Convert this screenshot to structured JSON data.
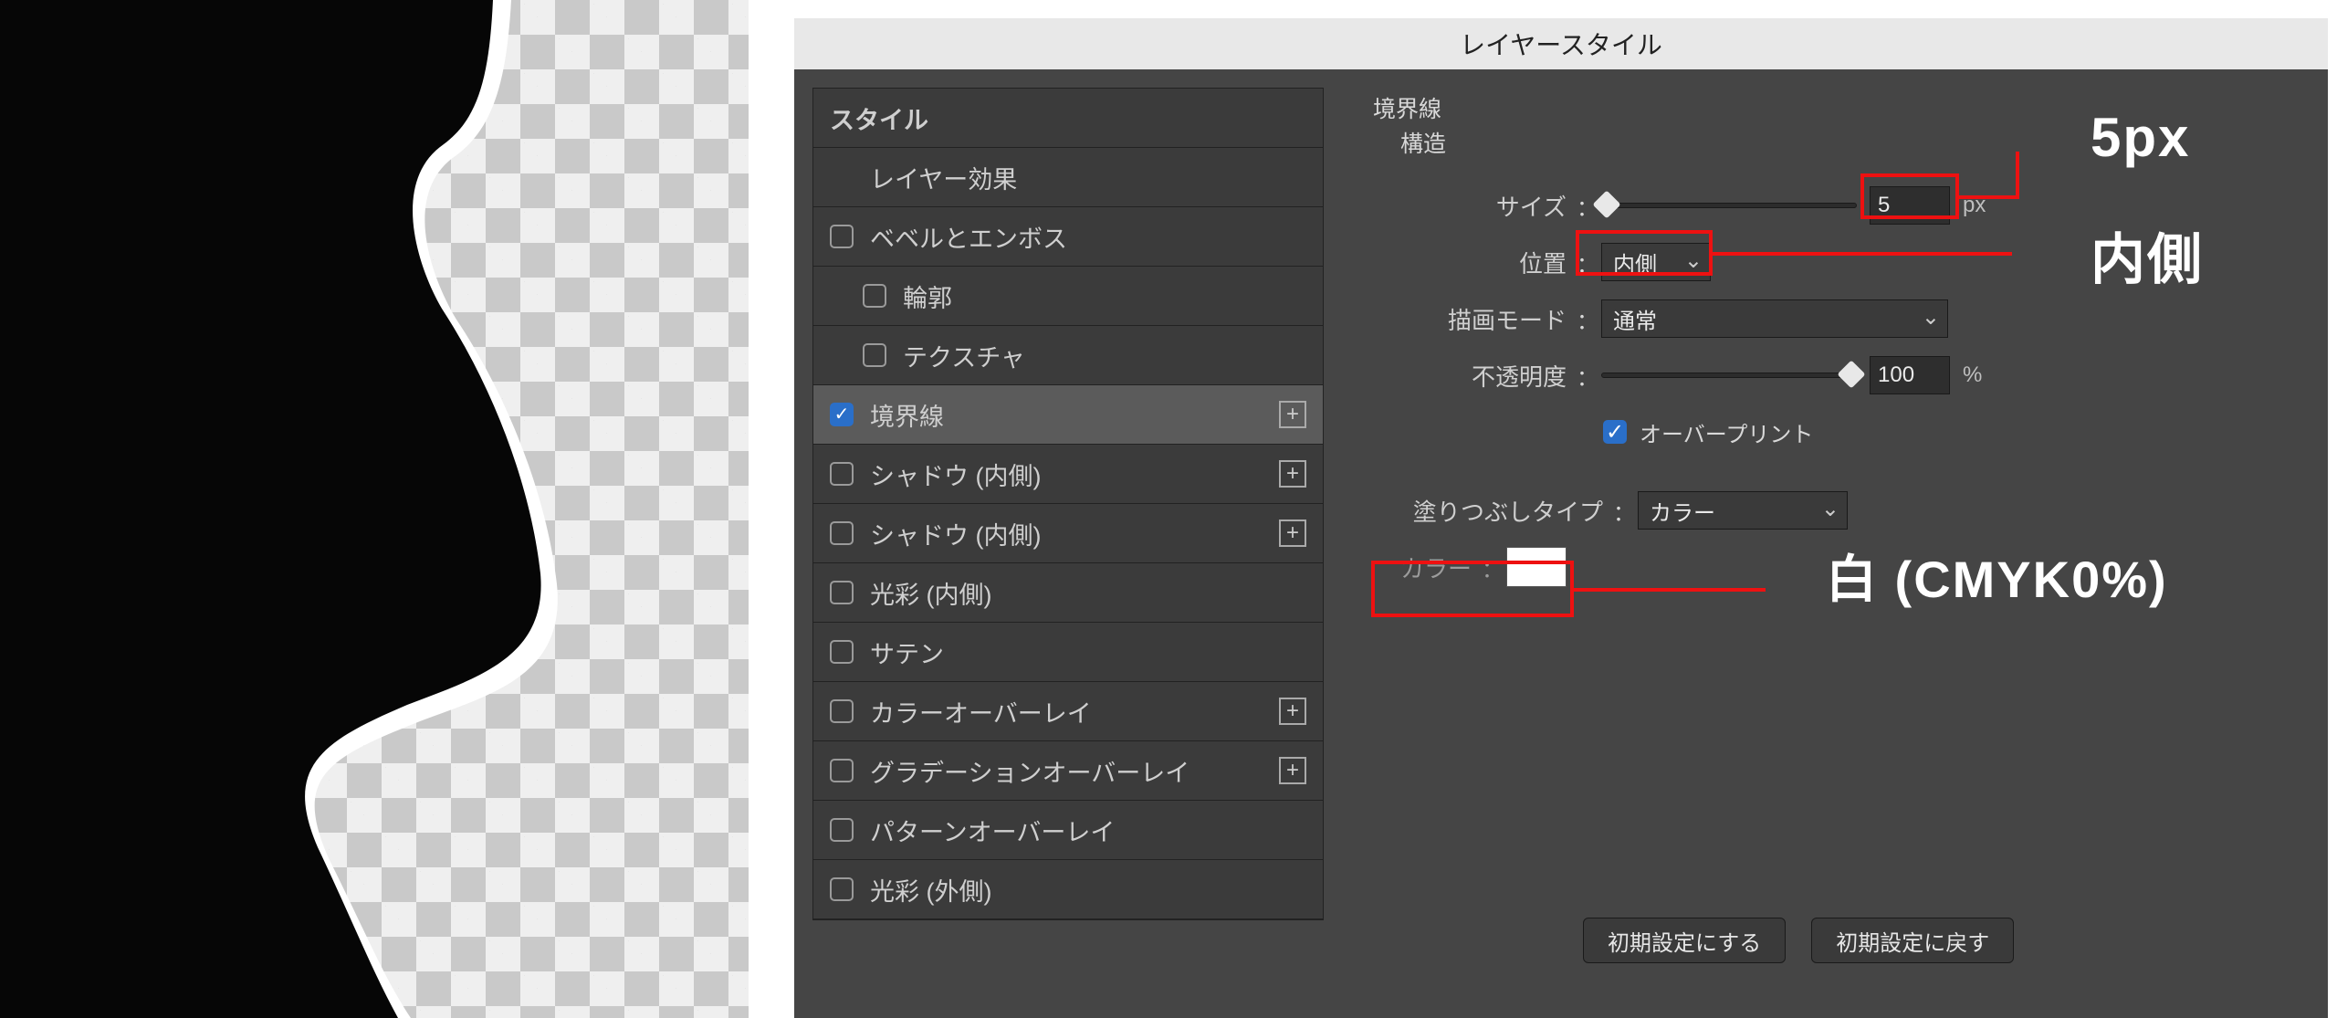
{
  "dialog": {
    "title": "レイヤースタイル",
    "styles_header": "スタイル",
    "styles": [
      {
        "label": "レイヤー効果",
        "checkbox": false,
        "checked": false,
        "plus": false,
        "indent": 0
      },
      {
        "label": "ベベルとエンボス",
        "checkbox": true,
        "checked": false,
        "plus": false,
        "indent": 0
      },
      {
        "label": "輪郭",
        "checkbox": true,
        "checked": false,
        "plus": false,
        "indent": 1
      },
      {
        "label": "テクスチャ",
        "checkbox": true,
        "checked": false,
        "plus": false,
        "indent": 1
      },
      {
        "label": "境界線",
        "checkbox": true,
        "checked": true,
        "plus": true,
        "indent": 0,
        "selected": true
      },
      {
        "label": "シャドウ (内側)",
        "checkbox": true,
        "checked": false,
        "plus": true,
        "indent": 0
      },
      {
        "label": "シャドウ (内側)",
        "checkbox": true,
        "checked": false,
        "plus": true,
        "indent": 0
      },
      {
        "label": "光彩 (内側)",
        "checkbox": true,
        "checked": false,
        "plus": false,
        "indent": 0
      },
      {
        "label": "サテン",
        "checkbox": true,
        "checked": false,
        "plus": false,
        "indent": 0
      },
      {
        "label": "カラーオーバーレイ",
        "checkbox": true,
        "checked": false,
        "plus": true,
        "indent": 0
      },
      {
        "label": "グラデーションオーバーレイ",
        "checkbox": true,
        "checked": false,
        "plus": true,
        "indent": 0
      },
      {
        "label": "パターンオーバーレイ",
        "checkbox": true,
        "checked": false,
        "plus": false,
        "indent": 0
      },
      {
        "label": "光彩 (外側)",
        "checkbox": true,
        "checked": false,
        "plus": false,
        "indent": 0
      }
    ],
    "section": {
      "title": "境界線",
      "subtitle": "構造",
      "size_label": "サイズ",
      "size_value": "5",
      "size_unit": "px",
      "position_label": "位置",
      "position_value": "内側",
      "blend_label": "描画モード",
      "blend_value": "通常",
      "opacity_label": "不透明度",
      "opacity_value": "100",
      "opacity_unit": "%",
      "overprint_label": "オーバープリント",
      "filltype_label": "塗りつぶしタイプ",
      "filltype_value": "カラー",
      "color_label": "カラー",
      "color_swatch": "#ffffff",
      "btn_default": "初期設定にする",
      "btn_reset": "初期設定に戻す"
    }
  },
  "annotations": {
    "a1": "5px",
    "a2": "内側",
    "a3": "白 (CMYK0%)"
  }
}
